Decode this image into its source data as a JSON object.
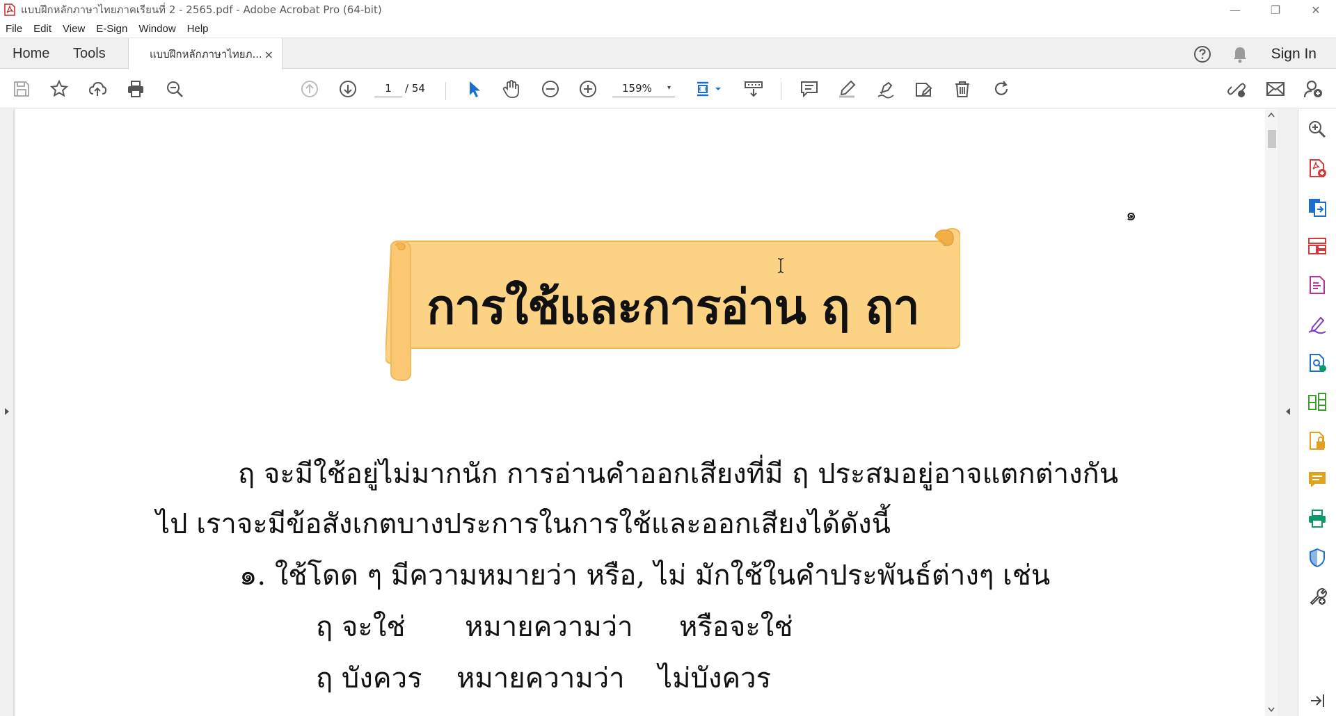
{
  "window": {
    "title": "แบบฝึกหลักภาษาไทยภาคเรียนที่ 2 - 2565.pdf - Adobe Acrobat Pro (64-bit)",
    "controls": {
      "minimize": "—",
      "restore": "❐",
      "close": "✕"
    }
  },
  "menu": {
    "items": [
      "File",
      "Edit",
      "View",
      "E-Sign",
      "Window",
      "Help"
    ]
  },
  "tabs": {
    "home": "Home",
    "tools": "Tools",
    "document": "แบบฝึกหลักภาษาไทยภ...",
    "close": "×",
    "sign_in": "Sign In"
  },
  "toolbar": {
    "page_current": "1",
    "page_total": "/ 54",
    "zoom": "159%",
    "zoom_caret": "▾"
  },
  "page": {
    "number": "๑",
    "title": "การใช้และการอ่าน ฤ ฤา",
    "lines": [
      "ฤ   จะมีใช้อยู่ไม่มากนัก   การอ่านคำออกเสียงที่มี   ฤ   ประสมอยู่อาจแตกต่างกัน",
      "ไป   เราจะมีข้อสังเกตบางประการในการใช้และออกเสียงได้ดังนี้",
      "๑. ใช้โดด ๆ   มีความหมายว่า   หรือ,  ไม่   มักใช้ในคำประพันธ์ต่างๆ   เช่น",
      "ฤ จะใช่",
      "หมายความว่า",
      "หรือจะใช่",
      "ฤ บังควร",
      "หมายความว่า",
      "ไม่บังควร"
    ]
  },
  "colors": {
    "banner_fill": "#fcd385",
    "banner_edge": "#f0b95a",
    "accent_blue": "#1d6fce"
  }
}
